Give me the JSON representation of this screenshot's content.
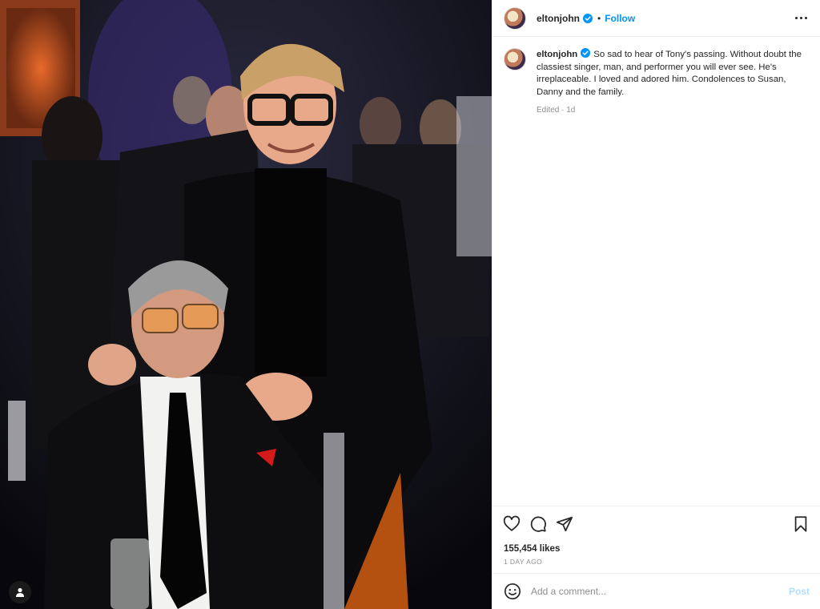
{
  "post": {
    "username": "eltonjohn",
    "verified": true,
    "separator": "•",
    "follow_label": "Follow",
    "caption_text": "So sad to hear of Tony's passing. Without doubt the classiest singer, man, and performer you will ever see. He's irreplaceable. I loved and adored him. Condolences to Susan, Danny and the family.",
    "caption_meta": "Edited · 1d",
    "likes": "155,454 likes",
    "date": "1 DAY AGO"
  },
  "comment": {
    "placeholder": "Add a comment...",
    "post_label": "Post"
  },
  "colors": {
    "accent": "#0095f6",
    "post_disabled": "#b2dffc",
    "verified": "#0095f6"
  },
  "icons": [
    "heart-icon",
    "comment-icon",
    "share-icon",
    "bookmark-icon",
    "emoji-icon",
    "more-icon",
    "user-tag-icon",
    "verified-badge-icon"
  ]
}
